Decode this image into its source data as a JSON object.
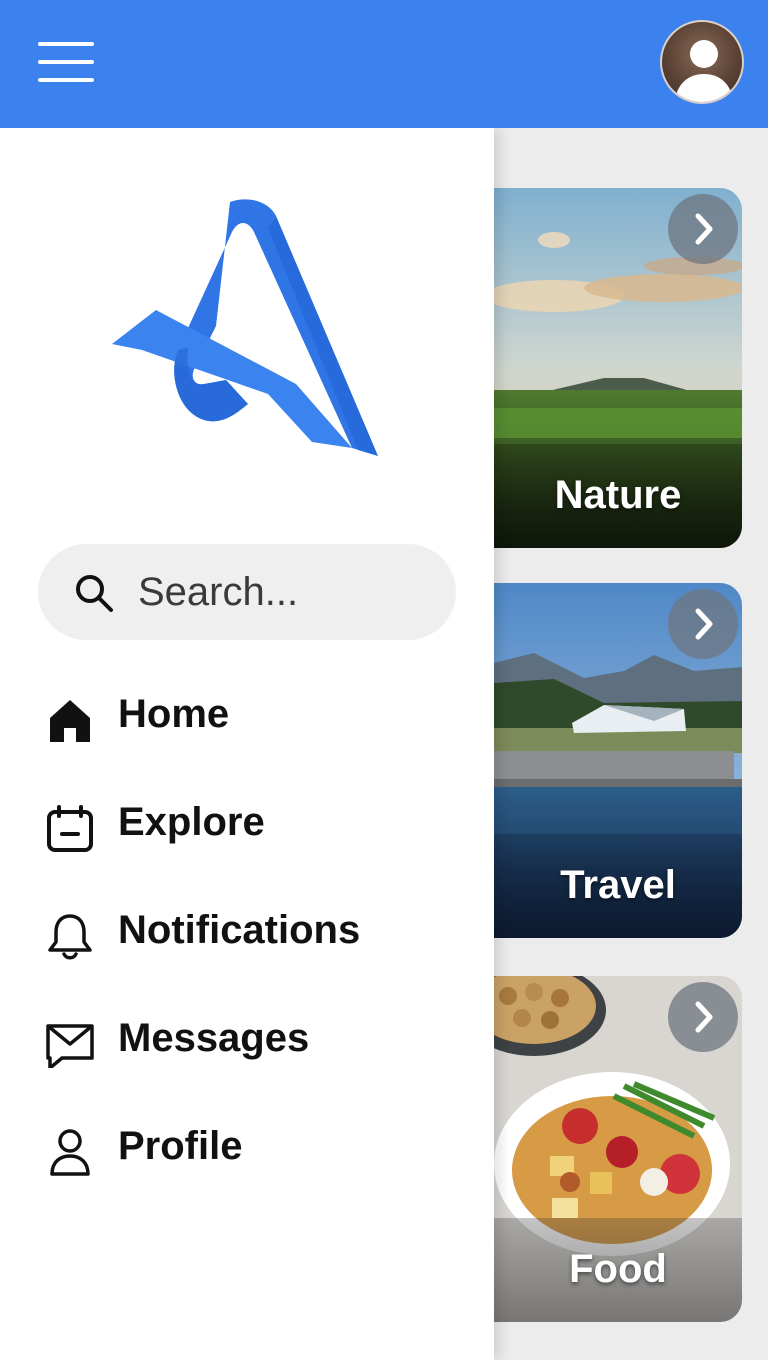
{
  "search": {
    "placeholder": "Search..."
  },
  "nav": {
    "items": [
      {
        "label": "Home",
        "icon": "home-icon"
      },
      {
        "label": "Explore",
        "icon": "calendar-icon"
      },
      {
        "label": "Notifications",
        "icon": "bell-icon"
      },
      {
        "label": "Messages",
        "icon": "mail-icon"
      },
      {
        "label": "Profile",
        "icon": "person-icon"
      }
    ]
  },
  "cards": [
    {
      "label": "Nature",
      "icon": "chevron-right-icon"
    },
    {
      "label": "Travel",
      "icon": "chevron-right-icon"
    },
    {
      "label": "Food",
      "icon": "chevron-right-icon"
    }
  ],
  "header": {
    "menu_icon": "hamburger-menu-icon",
    "avatar": "user-avatar"
  },
  "colors": {
    "brand": "#3b82ee",
    "drawer_bg": "#ffffff",
    "search_bg": "#efefef",
    "text": "#111111"
  }
}
